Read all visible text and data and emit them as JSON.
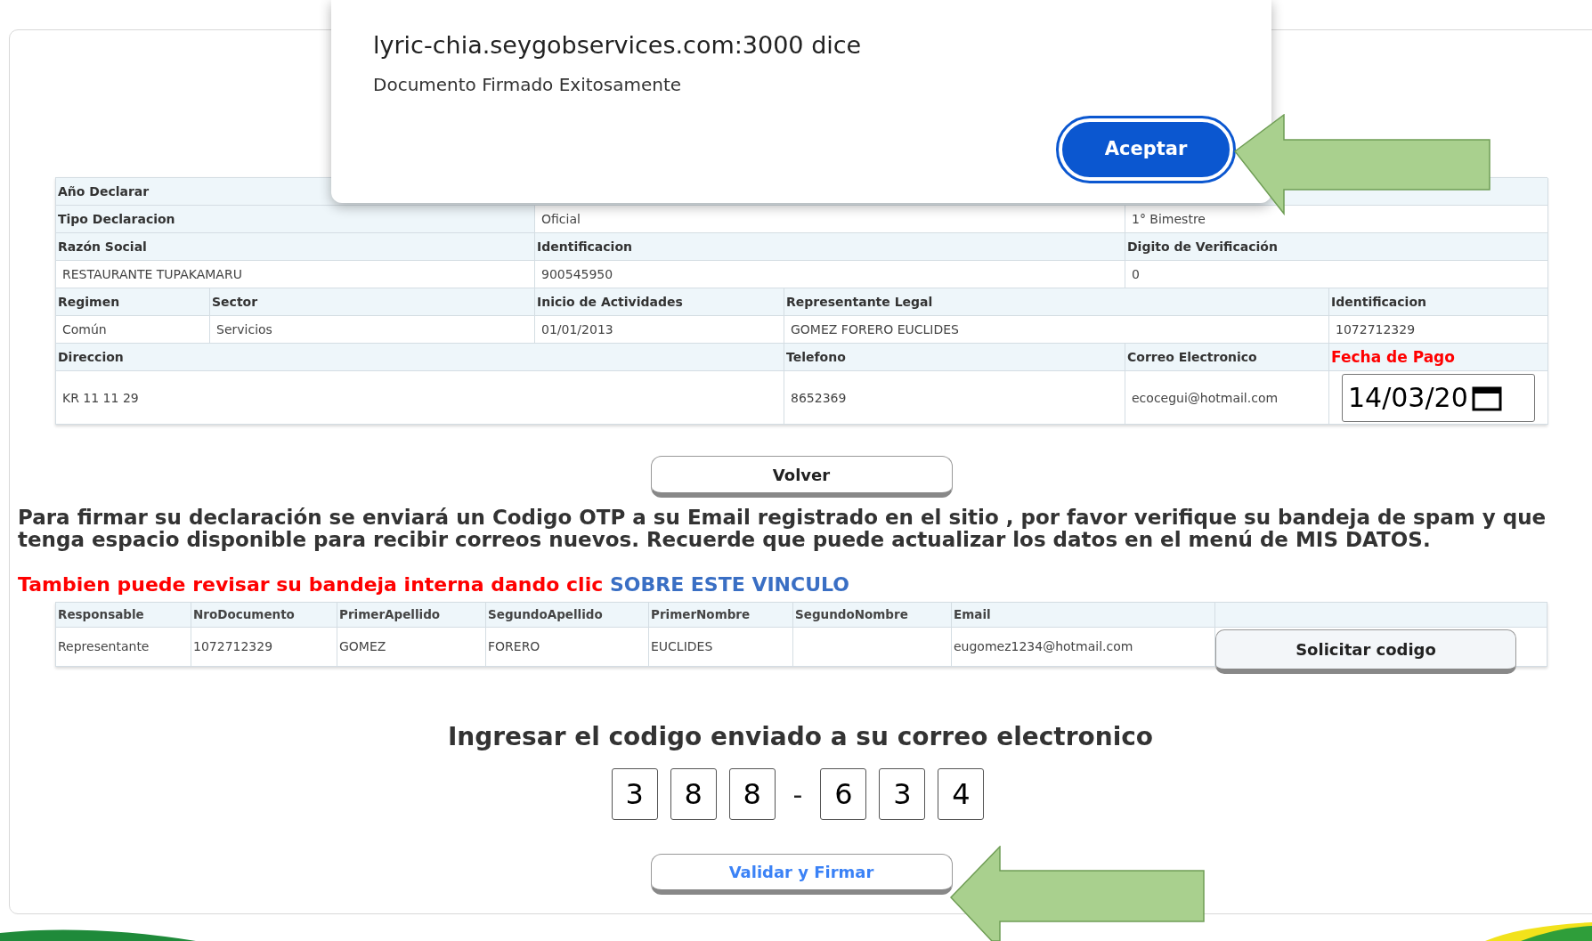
{
  "dialog": {
    "title": "lyric-chia.seygobservices.com:3000 dice",
    "message": "Documento Firmado Exitosamente",
    "button": "Aceptar"
  },
  "declaration": {
    "rows": [
      {
        "cells": [
          {
            "text": "Año Declarar",
            "kind": "label"
          }
        ]
      },
      {
        "cells": [
          {
            "text": "Tipo Declaracion",
            "kind": "label"
          },
          {
            "text": "Oficial",
            "kind": "value"
          },
          {
            "text": "1° Bimestre",
            "kind": "value"
          }
        ]
      },
      {
        "cells": [
          {
            "text": "Razón Social",
            "kind": "label"
          },
          {
            "text": "Identificacion",
            "kind": "label"
          },
          {
            "text": "Digito de Verificación",
            "kind": "label"
          }
        ]
      },
      {
        "cells": [
          {
            "text": "RESTAURANTE TUPAKAMARU",
            "kind": "value"
          },
          {
            "text": "900545950",
            "kind": "value"
          },
          {
            "text": "0",
            "kind": "value"
          }
        ]
      },
      {
        "cells": [
          {
            "text": "Regimen",
            "kind": "label"
          },
          {
            "text": "Sector",
            "kind": "label"
          },
          {
            "text": "Inicio de Actividades",
            "kind": "label"
          },
          {
            "text": "Representante Legal",
            "kind": "label"
          },
          {
            "text": "Identificacion",
            "kind": "label"
          }
        ]
      },
      {
        "cells": [
          {
            "text": "Común",
            "kind": "value"
          },
          {
            "text": "Servicios",
            "kind": "value"
          },
          {
            "text": "01/01/2013",
            "kind": "value"
          },
          {
            "text": "GOMEZ FORERO EUCLIDES",
            "kind": "value"
          },
          {
            "text": "1072712329",
            "kind": "value"
          }
        ]
      },
      {
        "cells": [
          {
            "text": "Direccion",
            "kind": "label"
          },
          {
            "text": "Telefono",
            "kind": "label"
          },
          {
            "text": "Correo Electronico",
            "kind": "label"
          },
          {
            "text": "Fecha de Pago",
            "kind": "required_label"
          }
        ]
      },
      {
        "cells": [
          {
            "text": "KR 11 11 29",
            "kind": "value"
          },
          {
            "text": "8652369",
            "kind": "value"
          },
          {
            "text": "ecocegui@hotmail.com",
            "kind": "value"
          },
          {
            "text": "14/03/20",
            "kind": "date"
          }
        ]
      }
    ]
  },
  "back_button": "Volver",
  "instructions": "Para firmar su declaración se enviará un Codigo OTP a su Email registrado en el sitio , por favor verifique su bandeja de spam y que tenga espacio disponible para recibir correos nuevos. Recuerde que puede actualizar los datos en el menú de MIS DATOS.",
  "notice": {
    "text": "Tambien puede revisar su bandeja interna dando clic",
    "link": "SOBRE ESTE VINCULO"
  },
  "signers": {
    "columns": [
      "Responsable",
      "NroDocumento",
      "PrimerApellido",
      "SegundoApellido",
      "PrimerNombre",
      "SegundoNombre",
      "Email"
    ],
    "rows": [
      {
        "cells": [
          "Representante",
          "1072712329",
          "GOMEZ",
          "FORERO",
          "EUCLIDES",
          "",
          "eugomez1234@hotmail.com"
        ],
        "button": "Solicitar codigo"
      }
    ]
  },
  "otp": {
    "heading": "Ingresar el codigo enviado a su correo electronico",
    "digits": [
      "3",
      "8",
      "8",
      "6",
      "3",
      "4"
    ],
    "separator": "-"
  },
  "submit_button": "Validar y Firmar"
}
